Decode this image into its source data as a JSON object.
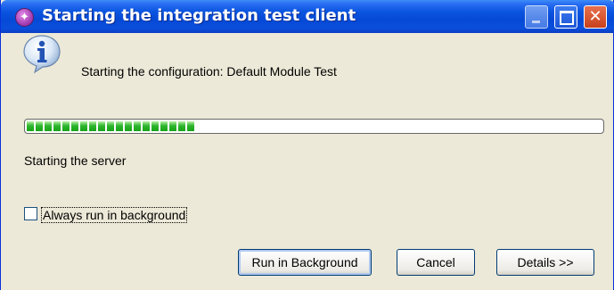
{
  "window": {
    "title": "Starting the integration test client",
    "app_icon_glyph": "✦",
    "close_glyph": "✕"
  },
  "message": {
    "icon": "info-icon",
    "text": "Starting the configuration: Default Module Test"
  },
  "progress": {
    "fraction": 0.31,
    "segments": 19,
    "status_text": "Starting the server",
    "color": "#22b022"
  },
  "checkbox": {
    "label": "Always run in background",
    "checked": false
  },
  "buttons": {
    "run_in_background": "Run in Background",
    "cancel": "Cancel",
    "details": "Details >>"
  },
  "colors": {
    "titlebar": "#0a55e0",
    "dialog_bg": "#ece9d8",
    "close_button": "#d0502b"
  }
}
